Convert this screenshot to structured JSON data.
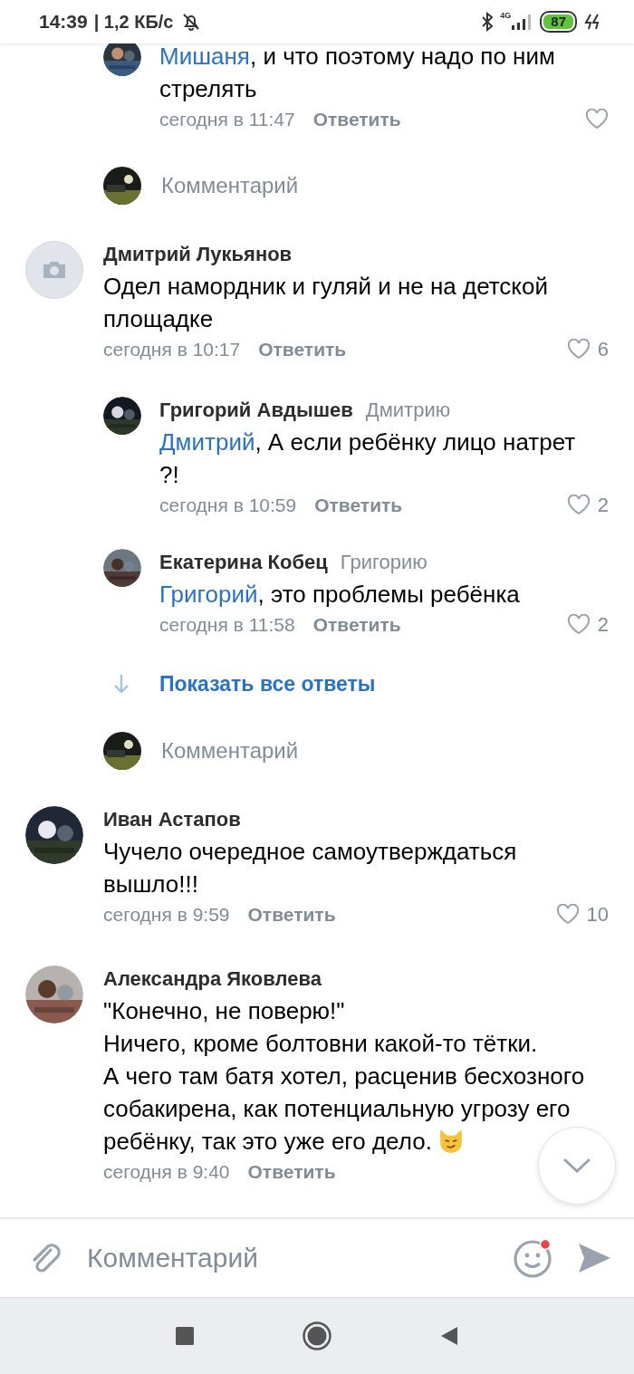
{
  "status_bar": {
    "time": "14:39",
    "speed": "| 1,2 КБ/с",
    "network": "4G",
    "battery": "87"
  },
  "feed": [
    {
      "kind": "reply",
      "has_photo": true,
      "mention": "Мишаня",
      "text": ", и что  поэтому надо по ним стрелять",
      "time": "сегодня в 11:47",
      "reply_label": "Ответить"
    },
    {
      "kind": "composer",
      "placeholder": "Комментарий"
    },
    {
      "kind": "comment",
      "has_photo": false,
      "name": "Дмитрий Лукьянов",
      "text": "Одел намордник и гуляй и не на детской площадке",
      "time": "сегодня в 10:17",
      "reply_label": "Ответить",
      "likes": "6"
    },
    {
      "kind": "reply",
      "has_photo": true,
      "name": "Григорий Авдышев",
      "to": "Дмитрию",
      "mention": "Дмитрий",
      "text": ", А если ребёнку лицо натрет ?!",
      "time": "сегодня в 10:59",
      "reply_label": "Ответить",
      "likes": "2"
    },
    {
      "kind": "reply",
      "has_photo": true,
      "name": "Екатерина Кобец",
      "to": "Григорию",
      "mention": "Григорий",
      "text": ", это проблемы ребёнка",
      "time": "сегодня в 11:58",
      "reply_label": "Ответить",
      "likes": "2"
    },
    {
      "kind": "show_more",
      "label": "Показать все ответы"
    },
    {
      "kind": "composer",
      "placeholder": "Комментарий"
    },
    {
      "kind": "comment",
      "has_photo": true,
      "name": "Иван Астапов",
      "text": "Чучело очередное самоутверждаться вышло!!!",
      "time": "сегодня в 9:59",
      "reply_label": "Ответить",
      "likes": "10"
    },
    {
      "kind": "comment",
      "has_photo": true,
      "name": "Александра Яковлева",
      "text": "\"Конечно, не поверю!\"\nНичего, кроме болтовни какой-то тётки.\nА чего там батя хотел, расценив бесхозного собакирена, как потенциальную угрозу его ребёнку, так это уже его дело.",
      "emoji": true,
      "time": "сегодня в 9:40",
      "reply_label": "Ответить"
    }
  ],
  "comment_bar": {
    "placeholder": "Комментарий",
    "emoji_badge": true
  }
}
